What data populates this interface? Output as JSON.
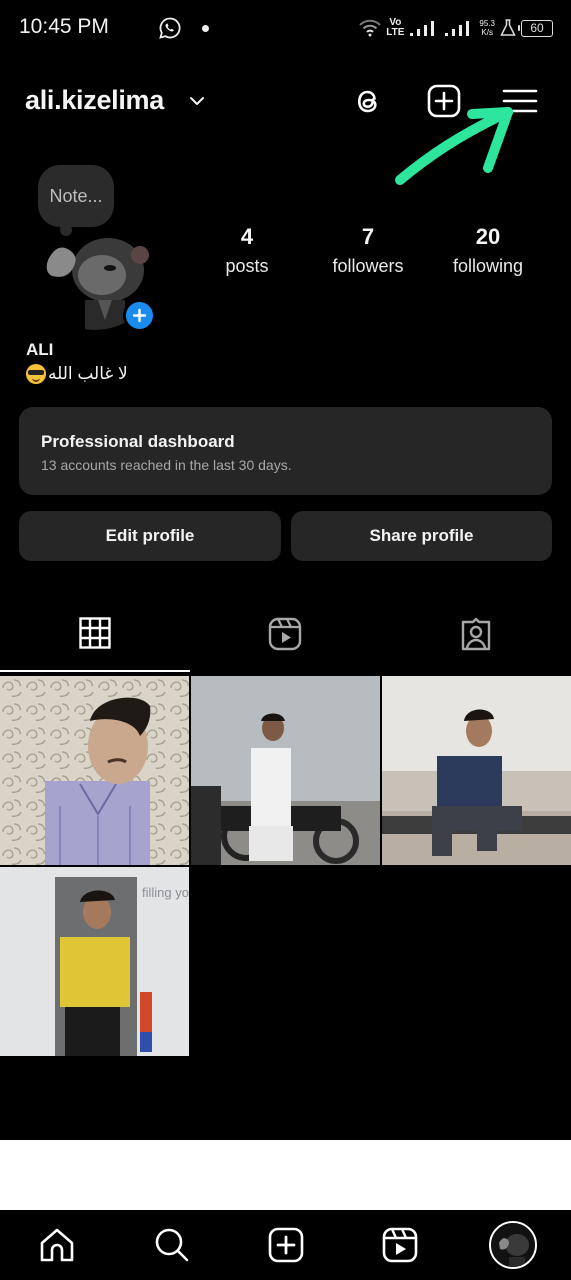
{
  "status_bar": {
    "time": "10:45 PM",
    "network_top": "Vo",
    "network_bottom": "LTE",
    "speed_value": "95.3",
    "speed_unit": "K/s",
    "battery": "60",
    "icons": [
      "whatsapp-icon",
      "notification-dot",
      "wifi-icon",
      "signal-icon",
      "signal-icon",
      "lab-icon",
      "battery-icon"
    ]
  },
  "header": {
    "username": "ali.kizelima",
    "icons": [
      "chevron-down-icon",
      "threads-icon",
      "create-post-icon",
      "menu-icon"
    ]
  },
  "annotation": {
    "type": "arrow",
    "color": "#2ee59d",
    "points_to": "menu-icon"
  },
  "profile": {
    "note_placeholder": "Note...",
    "display_name": "ALI",
    "bio_text": "لا غالب الله",
    "bio_emoji": "smiling-face-with-sunglasses",
    "stats": [
      {
        "value": "4",
        "label": "posts"
      },
      {
        "value": "7",
        "label": "followers"
      },
      {
        "value": "20",
        "label": "following"
      }
    ]
  },
  "dashboard": {
    "title": "Professional dashboard",
    "subtitle": "13 accounts reached in the last 30 days."
  },
  "actions": {
    "edit_label": "Edit profile",
    "share_label": "Share profile"
  },
  "tabs": [
    {
      "name": "posts-grid",
      "icon": "grid-icon",
      "active": true
    },
    {
      "name": "reels",
      "icon": "reels-icon",
      "active": false
    },
    {
      "name": "tagged",
      "icon": "tagged-icon",
      "active": false
    }
  ],
  "posts": [
    {
      "description": "Young man in light purple shirt against patterned background"
    },
    {
      "description": "Man in white kurta sitting on motorcycle outdoors"
    },
    {
      "description": "Man in blue hoodie crouching on wall outdoors"
    },
    {
      "description": "Man in yellow polo shirt standing indoors",
      "overlay_text": "filling you"
    }
  ],
  "bottom_nav": [
    {
      "name": "home",
      "icon": "home-icon"
    },
    {
      "name": "search",
      "icon": "search-icon"
    },
    {
      "name": "create",
      "icon": "create-icon"
    },
    {
      "name": "reels",
      "icon": "reels-icon"
    },
    {
      "name": "profile",
      "icon": "profile-avatar"
    }
  ],
  "colors": {
    "background": "#000000",
    "card": "#262626",
    "accent_blue": "#1a8cf0",
    "annotation_green": "#2ee59d",
    "secondary_text": "#a8a8a8"
  }
}
